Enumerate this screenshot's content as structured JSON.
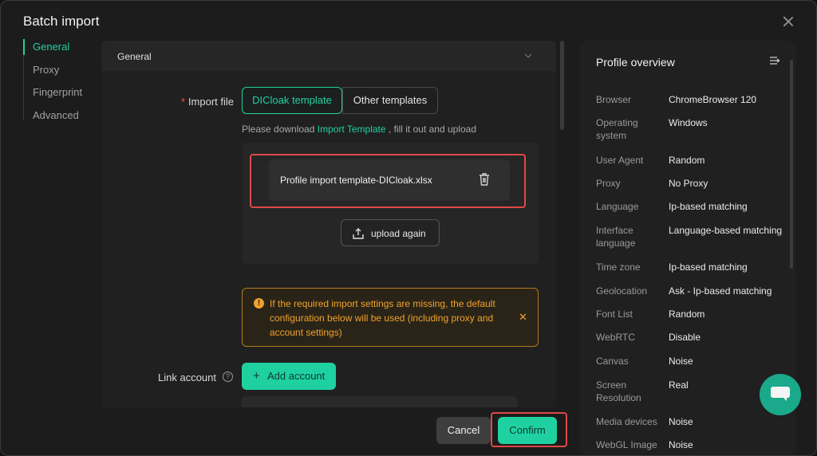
{
  "dialog": {
    "title": "Batch import"
  },
  "nav": {
    "items": [
      {
        "label": "General"
      },
      {
        "label": "Proxy"
      },
      {
        "label": "Fingerprint"
      },
      {
        "label": "Advanced"
      }
    ]
  },
  "general": {
    "section_label": "General",
    "import_file_label": "Import file",
    "required_mark": "*",
    "tabs": [
      {
        "label": "DICloak template"
      },
      {
        "label": "Other templates"
      }
    ],
    "hint_prefix": "Please download",
    "hint_link": "Import Template",
    "hint_suffix": ", fill it out and upload",
    "file_name": "Profile import template-DICloak.xlsx",
    "upload_again": "upload again",
    "warning": "If the required import settings are missing, the default configuration below will be used (including proxy and account settings)",
    "link_account_label": "Link account",
    "add_account": "Add account"
  },
  "footer": {
    "cancel": "Cancel",
    "confirm": "Confirm"
  },
  "overview": {
    "title": "Profile overview",
    "rows": [
      {
        "key": "Browser",
        "value": "ChromeBrowser 120"
      },
      {
        "key": "Operating system",
        "value": "Windows"
      },
      {
        "key": "User Agent",
        "value": "Random"
      },
      {
        "key": "Proxy",
        "value": "No Proxy"
      },
      {
        "key": "Language",
        "value": "Ip-based matching"
      },
      {
        "key": "Interface language",
        "value": "Language-based matching"
      },
      {
        "key": "Time zone",
        "value": "Ip-based matching"
      },
      {
        "key": "Geolocation",
        "value": "Ask - Ip-based matching"
      },
      {
        "key": "Font List",
        "value": "Random"
      },
      {
        "key": "WebRTC",
        "value": "Disable"
      },
      {
        "key": "Canvas",
        "value": "Noise"
      },
      {
        "key": "Screen Resolution",
        "value": "Real"
      },
      {
        "key": "Media devices",
        "value": "Noise"
      },
      {
        "key": "WebGL Image",
        "value": "Noise"
      }
    ]
  },
  "colors": {
    "accent": "#1fd1a1",
    "warning": "#f0a22b",
    "highlight": "#e04848"
  }
}
